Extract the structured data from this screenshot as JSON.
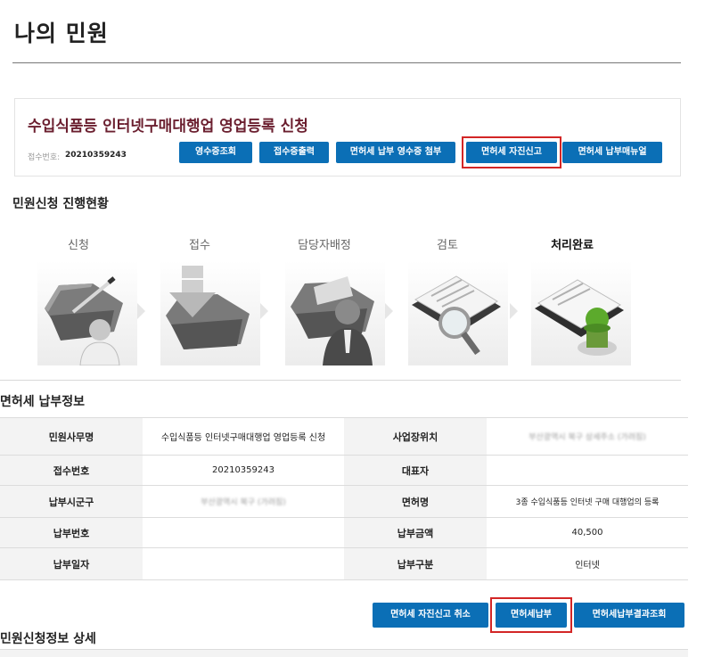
{
  "page": {
    "title": "나의 민원"
  },
  "application": {
    "title": "수입식품등 인터넷구매대행업 영업등록 신청",
    "receipt_label": "접수번호:",
    "receipt_number": "20210359243",
    "buttons": [
      "영수증조회",
      "접수증출력",
      "면허세 납부 영수증 첨부",
      "면허세 자진신고",
      "면허세 납부매뉴얼"
    ]
  },
  "progress": {
    "heading": "민원신청 진행현황",
    "steps": [
      {
        "label": "신청",
        "icon": "folder-pen-icon"
      },
      {
        "label": "접수",
        "icon": "folder-download-icon"
      },
      {
        "label": "담당자배정",
        "icon": "folder-person-icon"
      },
      {
        "label": "검토",
        "icon": "document-magnifier-icon"
      },
      {
        "label": "처리완료",
        "icon": "document-stamp-icon"
      }
    ],
    "current_step": "처리완료"
  },
  "payment_info": {
    "heading": "면허세 납부정보",
    "rows": [
      {
        "l1": "민원사무명",
        "v1": "수입식품등 인터넷구매대행업 영업등록 신청",
        "l2": "사업장위치",
        "v2": "부산광역시 북구 상세주소 (가려짐)"
      },
      {
        "l1": "접수번호",
        "v1": "20210359243",
        "l2": "대표자",
        "v2": ""
      },
      {
        "l1": "납부시군구",
        "v1": "부산광역시 북구 (가려짐)",
        "l2": "면허명",
        "v2": "3종 수입식품등 인터넷 구매 대행업의 등록"
      },
      {
        "l1": "납부번호",
        "v1": "",
        "l2": "납부금액",
        "v2": "40,500"
      },
      {
        "l1": "납부일자",
        "v1": "",
        "l2": "납부구분",
        "v2": "인터넷"
      }
    ]
  },
  "payment_actions": {
    "buttons": [
      "면허세 자진신고 취소",
      "면허세납부",
      "면허세납부결과조회"
    ]
  },
  "details": {
    "heading": "민원신청정보 상세"
  },
  "colors": {
    "button": "#0b6fb6",
    "highlight": "#d32626",
    "title": "#6b1f2f"
  }
}
